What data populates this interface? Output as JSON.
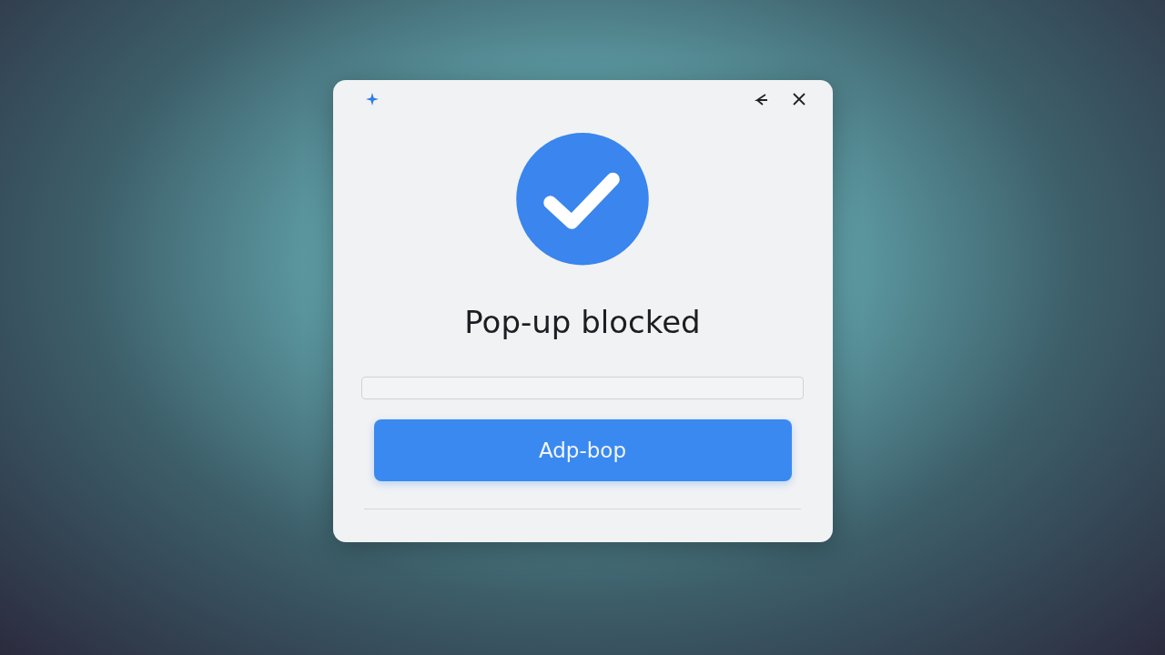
{
  "dialog": {
    "title": "Pop-up blocked",
    "button": "Adp-bop"
  }
}
